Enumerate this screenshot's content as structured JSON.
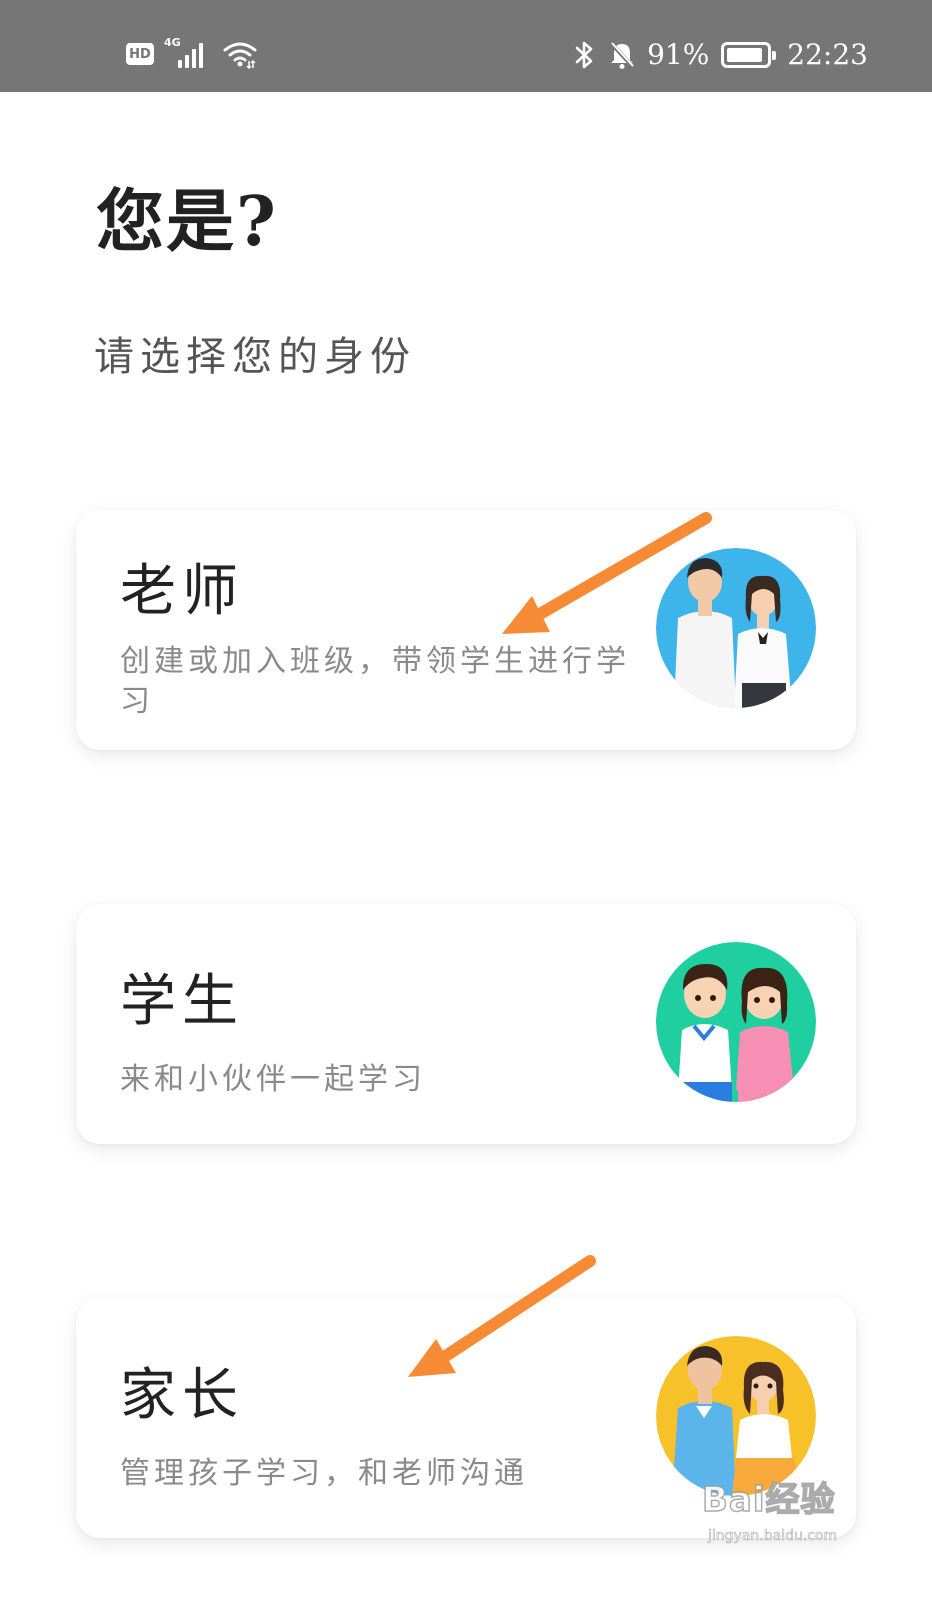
{
  "status_bar": {
    "hd_badge": "HD",
    "network_type": "4G",
    "battery_percent": "91%",
    "battery_level": 0.91,
    "time": "22:23",
    "icons": [
      "hd-icon",
      "signal-icon",
      "wifi-icon",
      "bluetooth-icon",
      "bell-off-icon",
      "battery-icon"
    ]
  },
  "header": {
    "title": "您是?",
    "subtitle": "请选择您的身份"
  },
  "roles": [
    {
      "title": "老师",
      "description": "创建或加入班级，带领学生进行学习",
      "image": "teacher-couple-illustration",
      "accent": "#3db4ea"
    },
    {
      "title": "学生",
      "description": "来和小伙伴一起学习",
      "image": "student-kids-illustration",
      "accent": "#1fcf9f"
    },
    {
      "title": "家长",
      "description": "管理孩子学习，和老师沟通",
      "image": "parent-couple-illustration",
      "accent": "#f7c12a"
    }
  ],
  "annotations": {
    "arrow_color": "#f78a35"
  },
  "watermark": {
    "logo": "Bai经验",
    "url": "jingyan.baidu.com"
  }
}
